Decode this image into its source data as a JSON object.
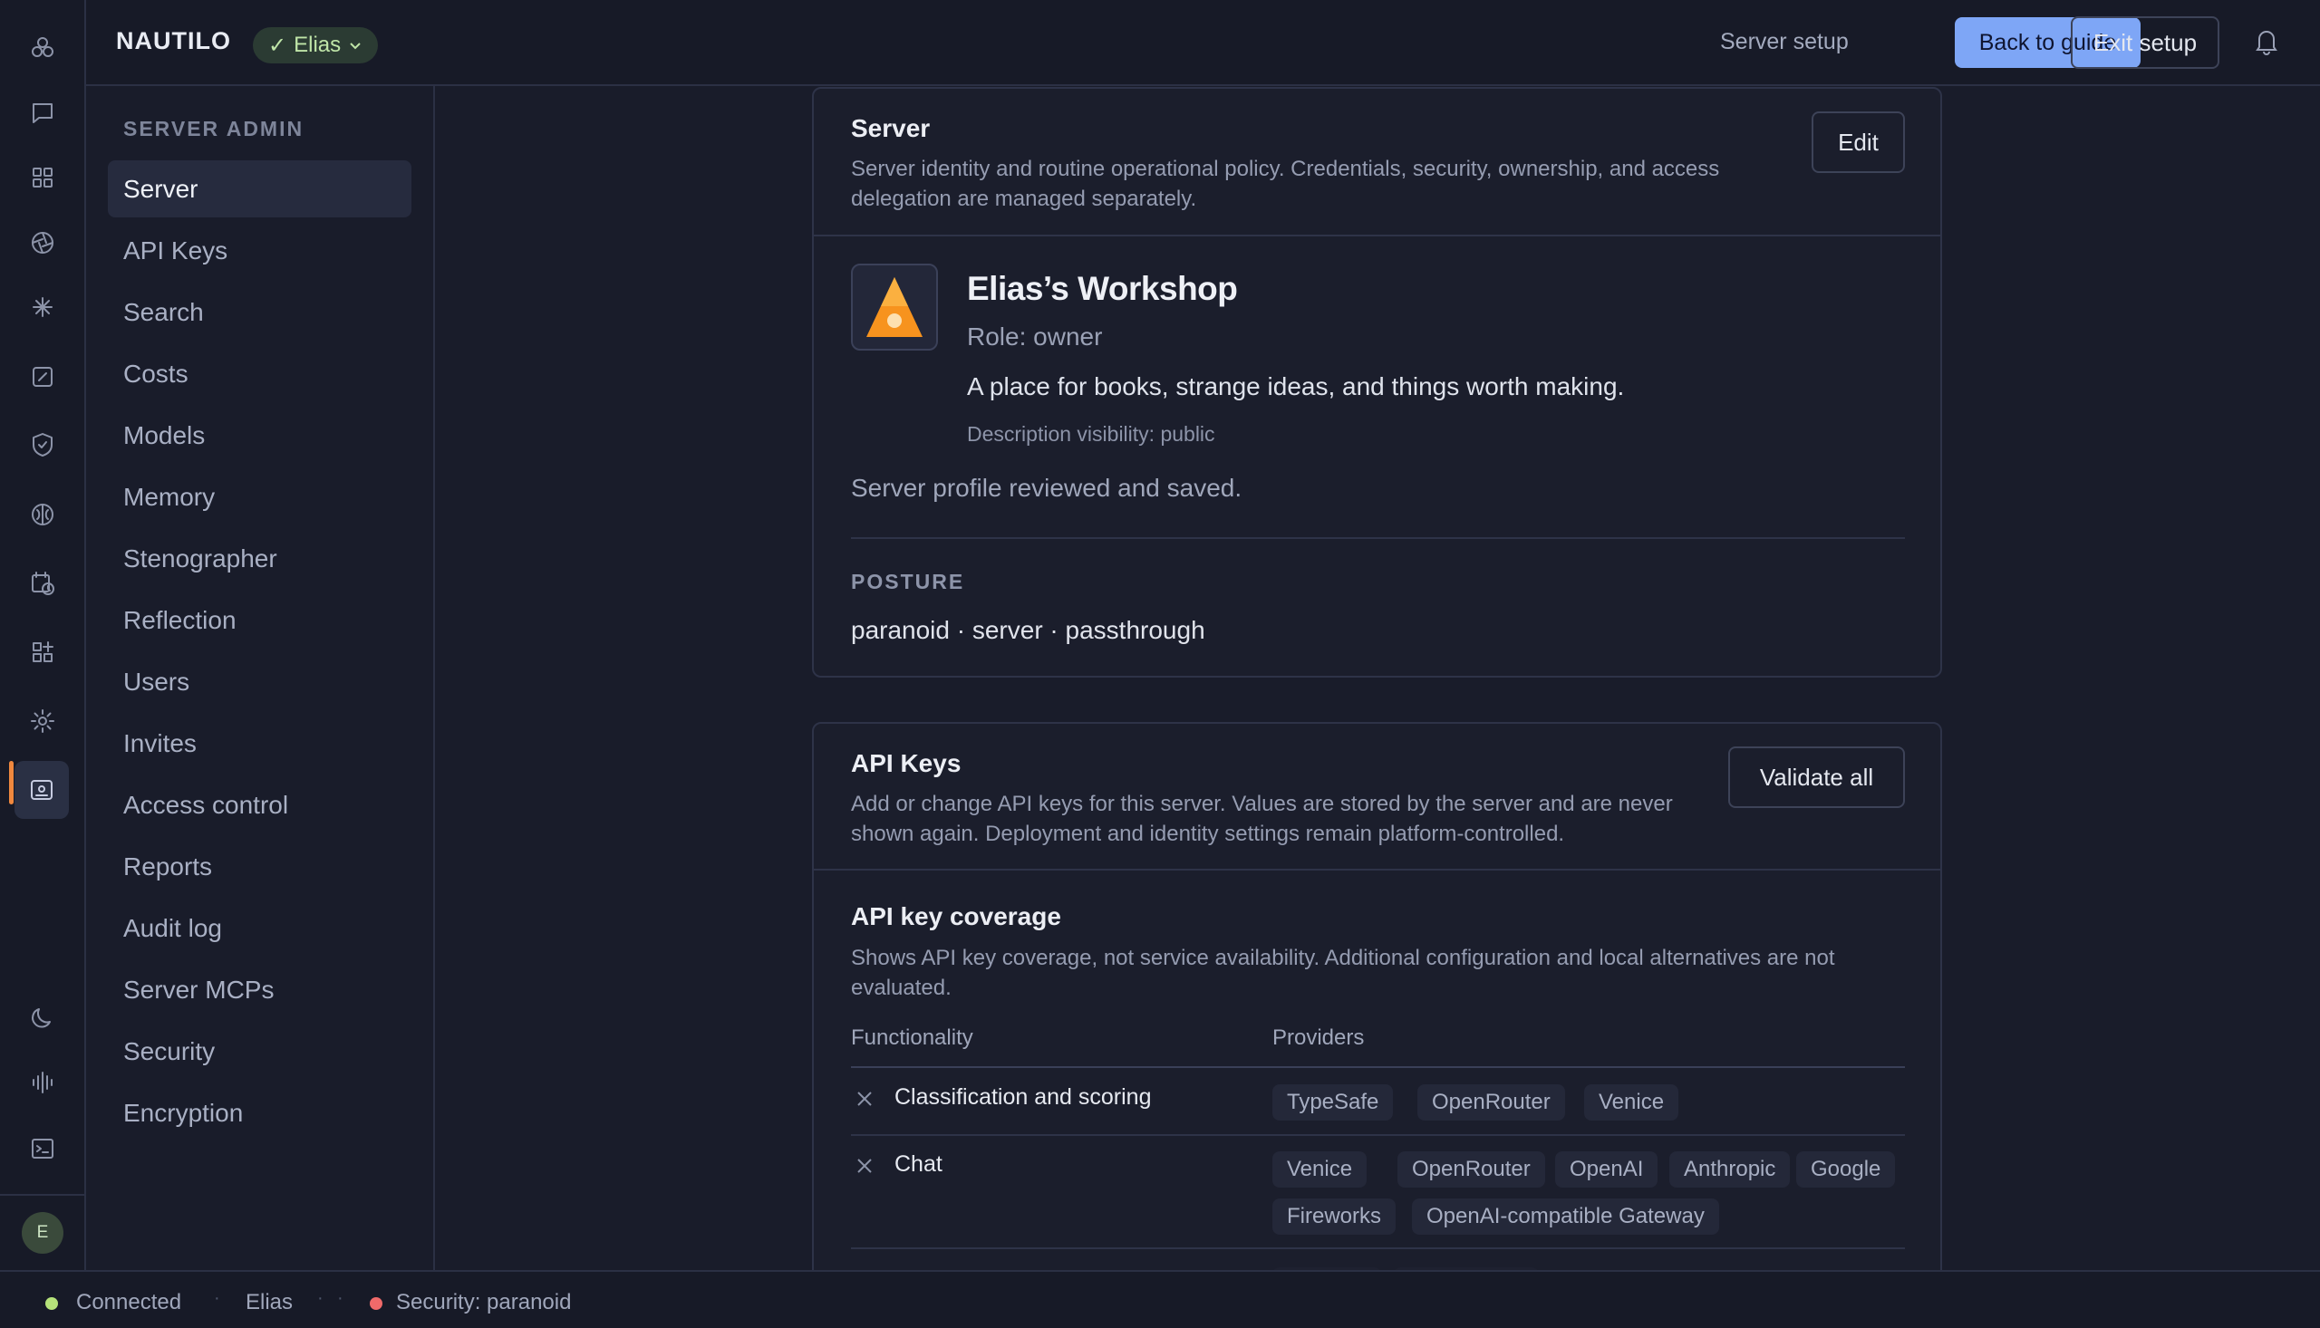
{
  "app": {
    "brand": "NAUTILO",
    "user": "Elias"
  },
  "colors": {
    "accent": "#7ea6f6",
    "connected": "#b5e27a",
    "security": "#f06a6a",
    "active_indicator": "#f0883e"
  },
  "rail": {
    "icons": [
      "cluster-icon",
      "chat-icon",
      "grid-icon",
      "aperture-icon",
      "sparkle-icon",
      "edit-square-icon",
      "shield-check-icon",
      "brain-icon",
      "calendar-clock-icon",
      "apps-add-icon",
      "gear-icon",
      "server-admin-icon",
      "moon-icon",
      "audio-wave-icon",
      "terminal-icon"
    ],
    "avatar_initial": "E"
  },
  "topbar": {
    "server_setup": "Server setup",
    "back_to_guide": "Back to guide",
    "exit_setup": "Exit setup"
  },
  "sidebar": {
    "heading": "SERVER ADMIN",
    "items": [
      {
        "label": "Server"
      },
      {
        "label": "API Keys"
      },
      {
        "label": "Search"
      },
      {
        "label": "Costs"
      },
      {
        "label": "Models"
      },
      {
        "label": "Memory"
      },
      {
        "label": "Stenographer"
      },
      {
        "label": "Reflection"
      },
      {
        "label": "Users"
      },
      {
        "label": "Invites"
      },
      {
        "label": "Access control"
      },
      {
        "label": "Reports"
      },
      {
        "label": "Audit log"
      },
      {
        "label": "Server MCPs"
      },
      {
        "label": "Security"
      },
      {
        "label": "Encryption"
      }
    ]
  },
  "server_card": {
    "title": "Server",
    "description": "Server identity and routine operational policy. Credentials, security, ownership, and access delegation are managed separately.",
    "edit": "Edit",
    "name": "Elias’s Workshop",
    "role": "Role: owner",
    "tagline": "A place for books, strange ideas, and things worth making.",
    "visibility": "Description visibility: public",
    "saved_note": "Server profile reviewed and saved.",
    "posture_label": "POSTURE",
    "posture_value": "paranoid · server · passthrough"
  },
  "api_card": {
    "title": "API Keys",
    "description": "Add or change API keys for this server. Values are stored by the server and are never shown again. Deployment and identity settings remain platform-controlled.",
    "validate_all": "Validate all",
    "coverage_title": "API key coverage",
    "coverage_desc": "Shows API key coverage, not service availability. Additional configuration and local alternatives are not evaluated.",
    "col_functionality": "Functionality",
    "col_providers": "Providers",
    "rows": [
      {
        "label": "Classification and scoring",
        "providers": [
          "TypeSafe",
          "OpenRouter",
          "Venice"
        ]
      },
      {
        "label": "Chat",
        "providers": [
          "Venice",
          "OpenRouter",
          "OpenAI",
          "Anthropic",
          "Google",
          "Fireworks",
          "OpenAI-compatible Gateway"
        ]
      }
    ]
  },
  "status": {
    "connected": "Connected",
    "user": "Elias",
    "security": "Security: paranoid",
    "separator": "·"
  }
}
